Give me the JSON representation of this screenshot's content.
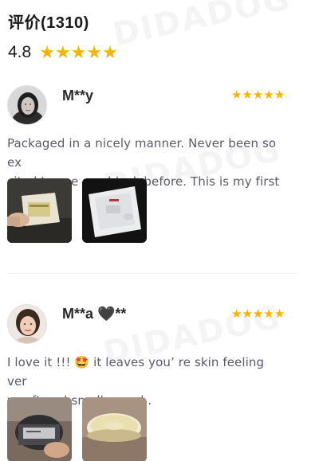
{
  "reviews_header": {
    "title": "评价(1310)",
    "average_score": "4.8",
    "average_stars": 4.8
  },
  "watermark_text": "DIDADOG",
  "reviews": [
    {
      "username": "M**y",
      "stars": 5,
      "text": "Packaged in a nicely manner. Never been so excited to use sun block before. This is my first ...",
      "text_line1": "Packaged in a nicely manner. Never been so ex",
      "text_line2": "cited to use sun block before. This is my first ...",
      "photos": [
        "review-photo-1",
        "review-photo-2"
      ]
    },
    {
      "username": "M**a 🖤**",
      "stars": 5,
      "text": "I love it !!! 🤩 it leaves you’ re skin feeling very soft and smells good .",
      "text_line1": "I love it !!! 🤩 it leaves you’ re skin feeling ver",
      "text_line2": "y soft and smells good .",
      "photos": [
        "review-photo-1",
        "review-photo-2"
      ]
    }
  ],
  "colors": {
    "star": "#f5b400",
    "body_text": "#5a5a6a",
    "title_text": "#1a1a1a"
  }
}
